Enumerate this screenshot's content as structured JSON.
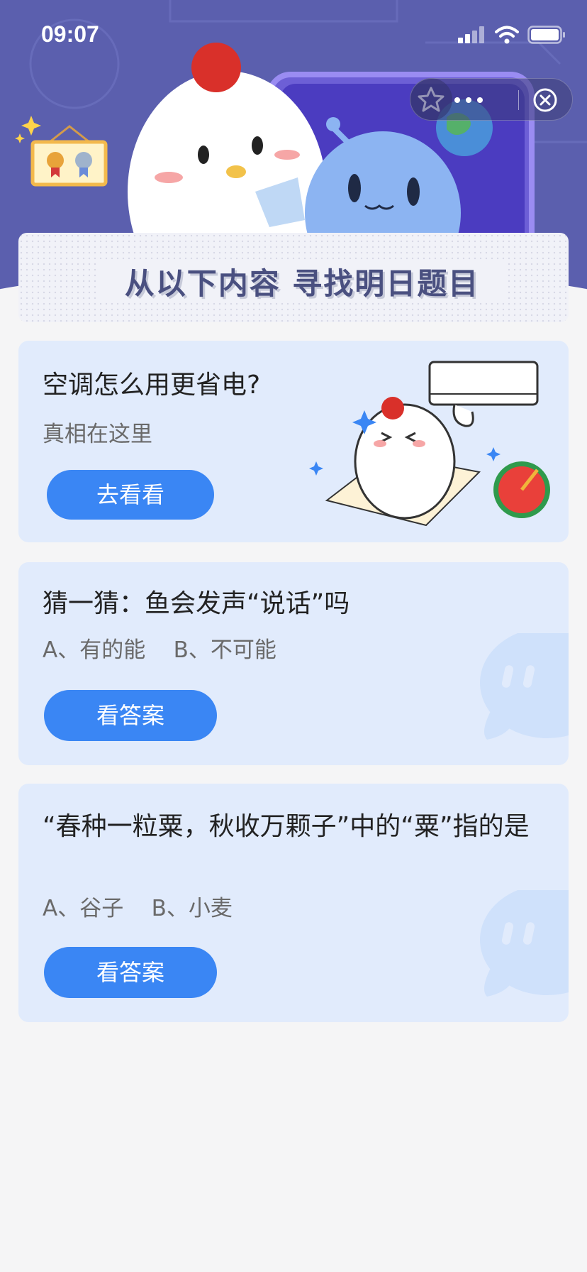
{
  "status_bar": {
    "time": "09:07"
  },
  "banner": {
    "title": "从以下内容 寻找明日题目"
  },
  "cards": [
    {
      "title": "空调怎么用更省电?",
      "subtitle": "真相在这里",
      "button": "去看看"
    },
    {
      "title": "猜一猜：鱼会发声“说话”吗",
      "options": "A、有的能    B、不可能",
      "button": "看答案"
    },
    {
      "title": "“春种一粒粟，秋收万颗子”中的“粟”指的是",
      "options": "A、谷子    B、小麦",
      "button": "看答案"
    }
  ],
  "colors": {
    "header_bg": "#5b5fae",
    "card_bg": "#e1ebfc",
    "button": "#3a86f4",
    "page_bg": "#f5f5f6"
  },
  "icons": [
    "signal-icon",
    "wifi-icon",
    "battery-icon",
    "star-icon",
    "more-icon",
    "close-icon",
    "medal-frame-icon"
  ]
}
